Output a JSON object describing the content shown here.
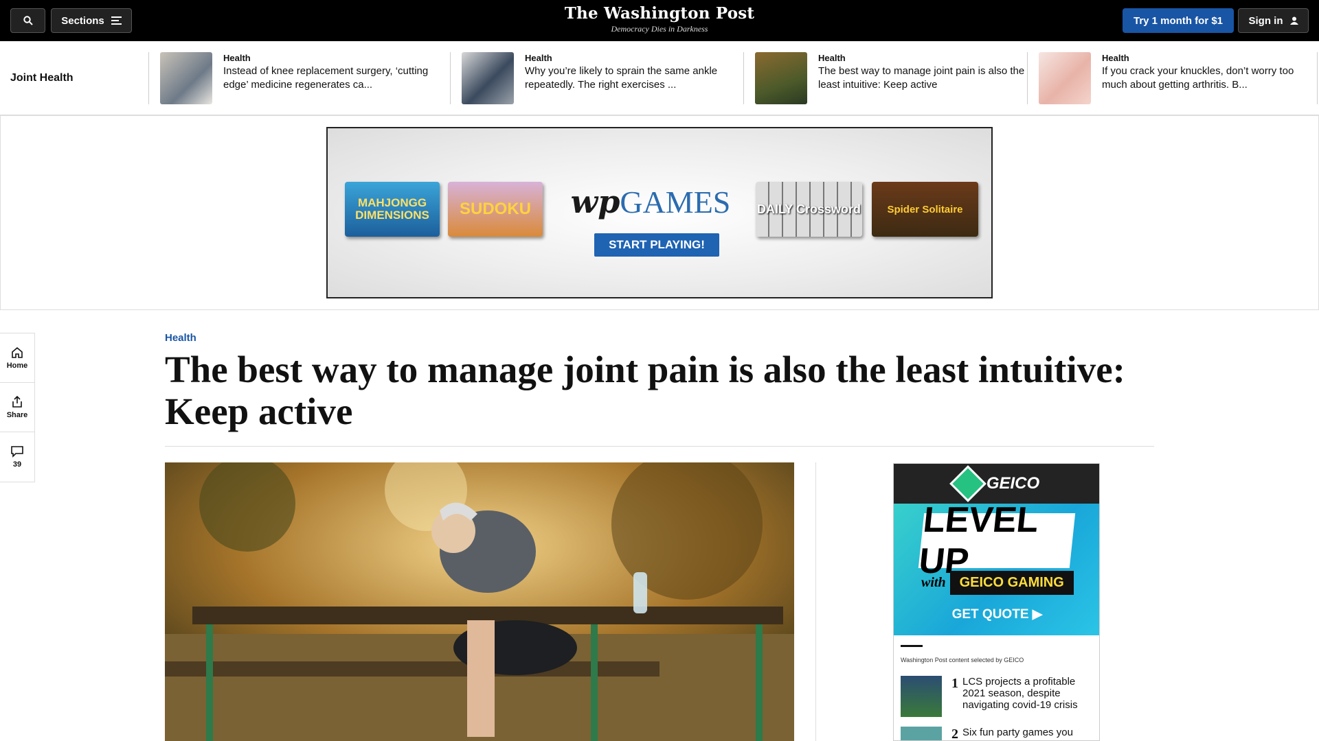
{
  "topbar": {
    "sections_label": "Sections",
    "logo": "The Washington Post",
    "tagline": "Democracy Dies in Darkness",
    "try_label": "Try 1 month for $1",
    "signin_label": "Sign in"
  },
  "strip": {
    "title": "Joint Health",
    "items": [
      {
        "kicker": "Health",
        "headline": "Instead of knee replacement surgery, ‘cutting edge’ medicine regenerates ca..."
      },
      {
        "kicker": "Health",
        "headline": "Why you’re likely to sprain the same ankle repeatedly. The right exercises ..."
      },
      {
        "kicker": "Health",
        "headline": "The best way to manage joint pain is also the least intuitive: Keep active"
      },
      {
        "kicker": "Health",
        "headline": "If you crack your knuckles, don’t worry too much about getting arthritis. B..."
      }
    ]
  },
  "ad_games": {
    "mahjongg": "MAHJONGG DIMENSIONS",
    "sudoku": "SUDOKU",
    "wp": "wp",
    "games": "GAMES",
    "play": "START PLAYING!",
    "crossword": "DAILY Crossword",
    "spider": "Spider Solitaire"
  },
  "rail": {
    "home": "Home",
    "share": "Share",
    "comments": "39"
  },
  "article": {
    "kicker": "Health",
    "headline": "The best way to manage joint pain is also the least intuitive: Keep active"
  },
  "geico": {
    "brand": "GEICO",
    "level": "LEVEL UP",
    "with": "with",
    "gaming": "GEICO GAMING",
    "quote": "GET QUOTE ▶",
    "selected": "Washington Post content selected by GEICO",
    "items": [
      {
        "num": "1",
        "title": "LCS projects a profitable 2021 season, despite navigating covid-19 crisis"
      },
      {
        "num": "2",
        "title": "Six fun party games you"
      }
    ]
  }
}
